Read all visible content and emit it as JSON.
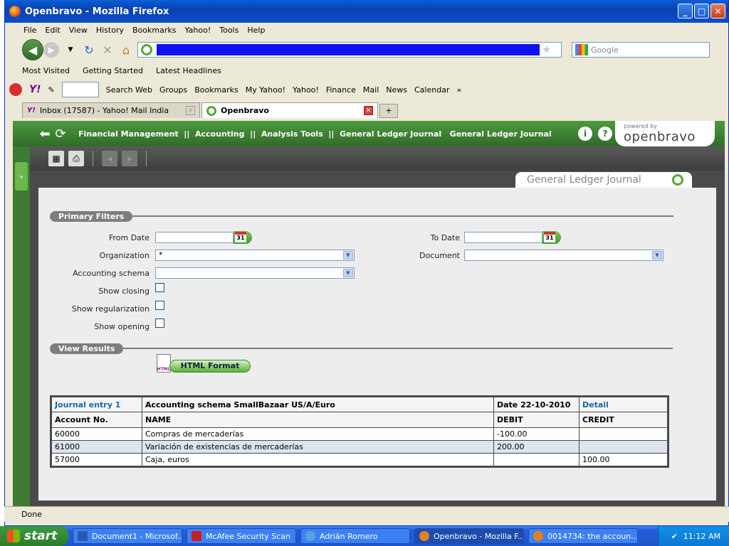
{
  "window": {
    "title": "Openbravo - Mozilla Firefox"
  },
  "menu": [
    "File",
    "Edit",
    "View",
    "History",
    "Bookmarks",
    "Yahoo!",
    "Tools",
    "Help"
  ],
  "search": {
    "placeholder": "Google"
  },
  "bookmarks": [
    "Most Visited",
    "Getting Started",
    "Latest Headlines"
  ],
  "yahoo_toolbar": {
    "search_web": "Search Web",
    "items": [
      "Groups",
      "Bookmarks",
      "My Yahoo!",
      "Yahoo!",
      "Finance",
      "Mail",
      "News",
      "Calendar"
    ],
    "more": "»"
  },
  "tabs": [
    {
      "label": "Inbox (17587) - Yahoo! Mail India"
    },
    {
      "label": "Openbravo"
    }
  ],
  "app": {
    "breadcrumb": "Financial Management  ||  Accounting  ||  Analysis Tools  ||  General Ledger Journal   General Ledger Journal",
    "logo_powered": "powered by",
    "logo_name": "openbravo",
    "window_title": "General Ledger Journal"
  },
  "filters": {
    "section": "Primary Filters",
    "from_date_label": "From Date",
    "to_date_label": "To Date",
    "organization_label": "Organization",
    "organization_value": "*",
    "document_label": "Document",
    "schema_label": "Accounting schema",
    "show_closing_label": "Show closing",
    "show_regularization_label": "Show regularization",
    "show_opening_label": "Show opening",
    "calendar_day": "31"
  },
  "results": {
    "section": "View Results",
    "html_button": "HTML Format",
    "html_doc_label": "HTML"
  },
  "journal": {
    "entry_link": "Journal entry 1",
    "schema": "Accounting schema SmallBazaar US/A/Euro",
    "date": "Date 22-10-2010",
    "detail_link": "Detail",
    "columns": [
      "Account No.",
      "NAME",
      "DEBIT",
      "CREDIT"
    ],
    "rows": [
      {
        "account": "60000",
        "name": "Compras de mercaderías",
        "debit": "-100.00",
        "credit": ""
      },
      {
        "account": "61000",
        "name": "Variación de existencias de mercaderías",
        "debit": "200.00",
        "credit": ""
      },
      {
        "account": "57000",
        "name": "Caja, euros",
        "debit": "",
        "credit": "100.00"
      }
    ]
  },
  "status": "Done",
  "taskbar": {
    "start": "start",
    "tasks": [
      "Document1 - Microsof...",
      "McAfee Security Scan",
      "Adrián Romero",
      "Openbravo - Mozilla F...",
      "0014734: the accoun..."
    ],
    "clock": "11:12 AM"
  }
}
